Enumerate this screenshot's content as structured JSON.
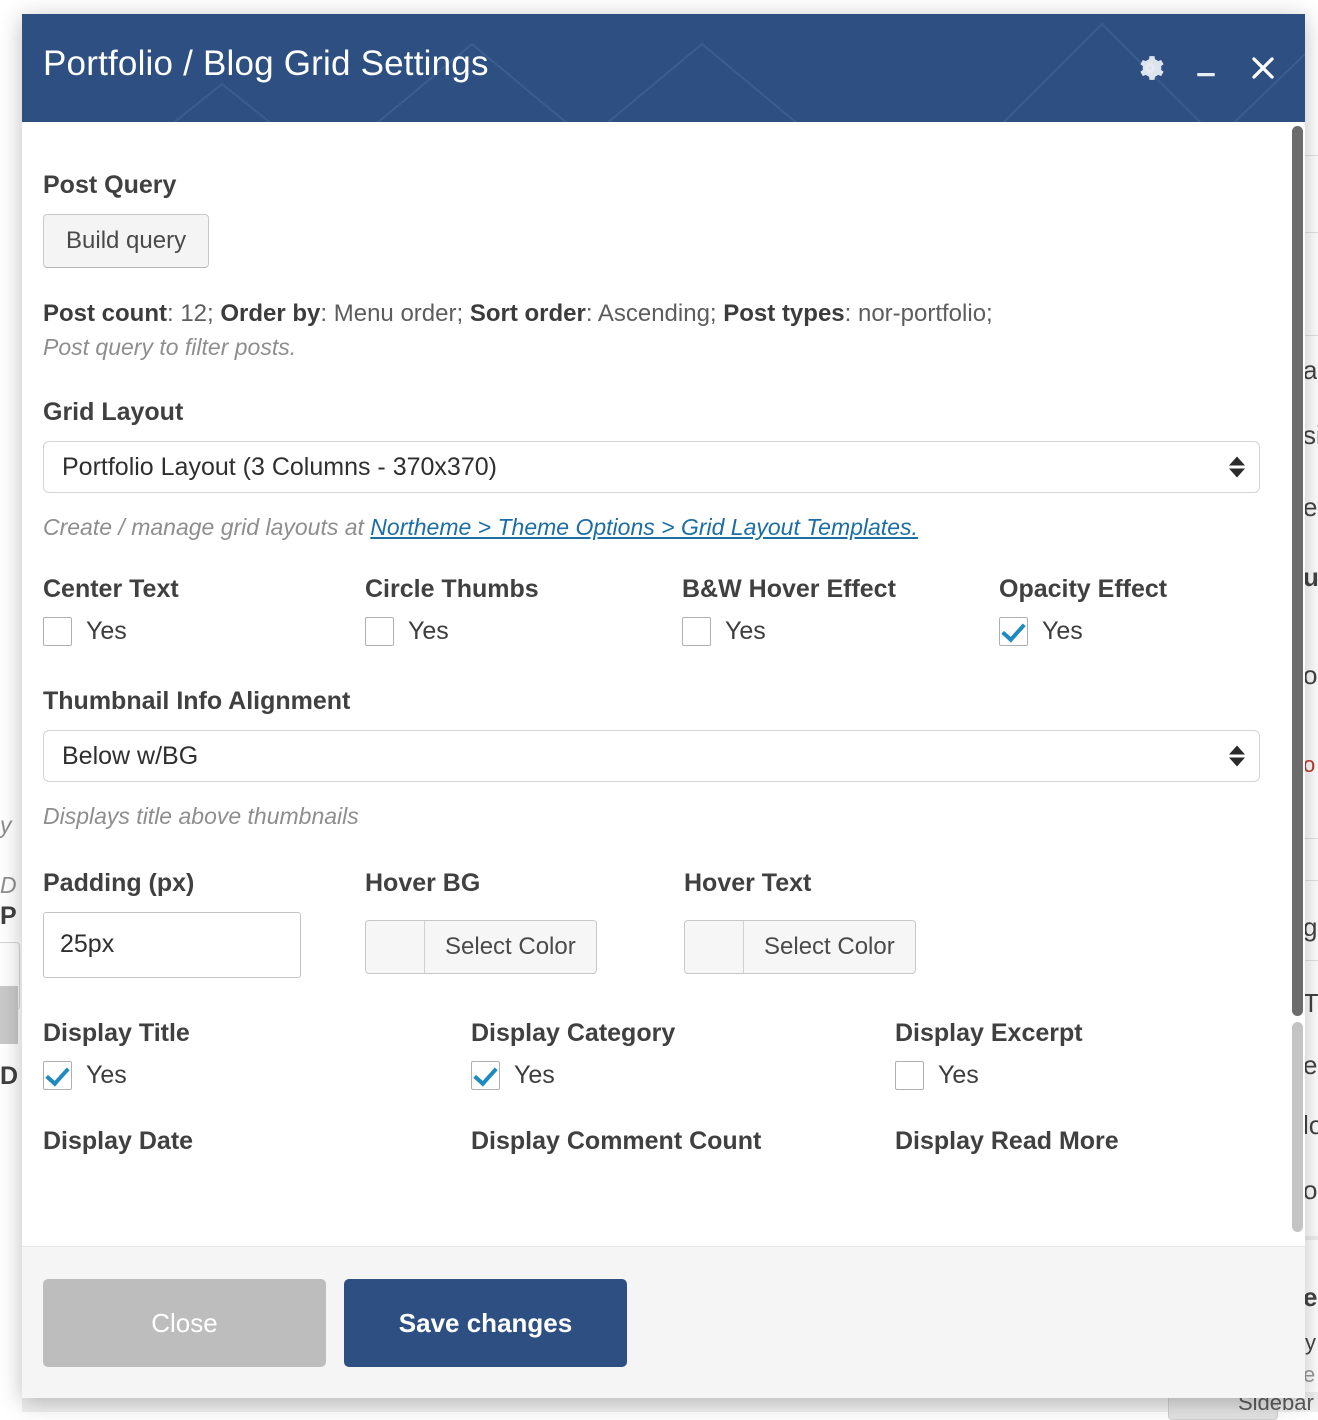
{
  "window": {
    "title": "Portfolio / Blog Grid Settings",
    "header_bg": "#2e4f81",
    "icons": {
      "settings": "gear-icon",
      "minimize": "minimize-icon",
      "close": "close-icon"
    }
  },
  "fields": {
    "post_query": {
      "label": "Post Query",
      "button": "Build query",
      "summary_parts": [
        {
          "bold": "Post count",
          "text": ": 12; "
        },
        {
          "bold": "Order by",
          "text": ": Menu order; "
        },
        {
          "bold": "Sort order",
          "text": ": Ascending; "
        },
        {
          "bold": "Post types",
          "text": ": nor-portfolio;"
        }
      ],
      "summary_plain": "Post count: 12; Order by: Menu order; Sort order: Ascending; Post types: nor-portfolio;",
      "description": "Post query to filter posts."
    },
    "grid_layout": {
      "label": "Grid Layout",
      "value": "Portfolio Layout (3 Columns - 370x370)",
      "help_prefix": "Create / manage grid layouts at ",
      "help_link": "Northeme > Theme Options > Grid Layout Templates."
    },
    "toggles_row1": [
      {
        "label": "Center Text",
        "option": "Yes",
        "checked": false
      },
      {
        "label": "Circle Thumbs",
        "option": "Yes",
        "checked": false
      },
      {
        "label": "B&W Hover Effect",
        "option": "Yes",
        "checked": false
      },
      {
        "label": "Opacity Effect",
        "option": "Yes",
        "checked": true
      }
    ],
    "thumbnail_info_alignment": {
      "label": "Thumbnail Info Alignment",
      "value": "Below w/BG",
      "description": "Displays title above thumbnails"
    },
    "padding": {
      "label": "Padding (px)",
      "value": "25px"
    },
    "hover_bg": {
      "label": "Hover BG",
      "button": "Select Color",
      "swatch": ""
    },
    "hover_text": {
      "label": "Hover Text",
      "button": "Select Color",
      "swatch": ""
    },
    "toggles_row2": [
      {
        "label": "Display Title",
        "option": "Yes",
        "checked": true
      },
      {
        "label": "Display Category",
        "option": "Yes",
        "checked": true
      },
      {
        "label": "Display Excerpt",
        "option": "Yes",
        "checked": false
      }
    ],
    "toggles_row3": [
      {
        "label": "Display Date"
      },
      {
        "label": "Display Comment Count"
      },
      {
        "label": "Display Read More"
      }
    ]
  },
  "footer": {
    "close_label": "Close",
    "save_label": "Save changes",
    "close_color": "#bdbdbd",
    "save_color": "#2e4f81"
  },
  "background": {
    "fragments": [
      "a",
      "si",
      "ev",
      "ub",
      "os",
      "o",
      "g",
      "T",
      "e",
      "lo",
      "o",
      "e",
      "y",
      "e",
      "Sidebar"
    ],
    "left_fragments": [
      "y",
      "D",
      "P",
      "D"
    ]
  }
}
